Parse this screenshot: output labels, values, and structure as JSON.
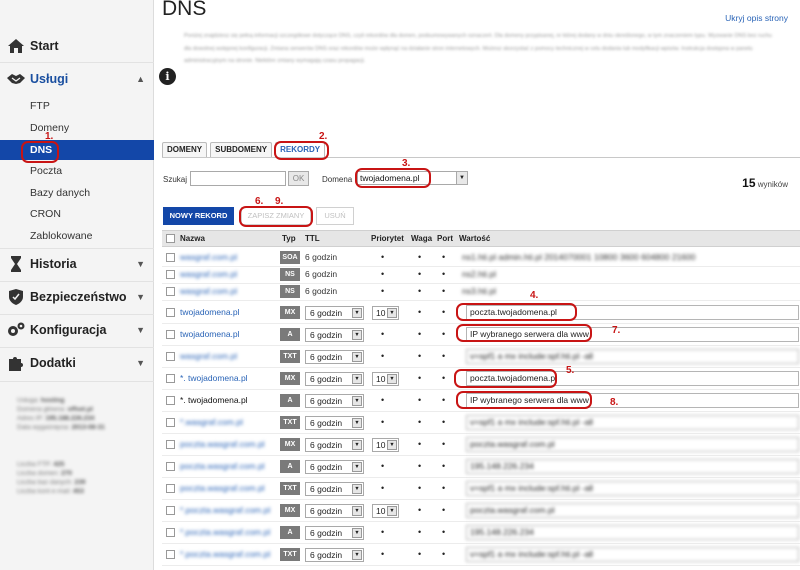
{
  "sidebar": {
    "items": [
      {
        "label": "Start",
        "icon": "home-icon"
      },
      {
        "label": "Usługi",
        "icon": "handshake-icon"
      },
      {
        "label": "Historia",
        "icon": "hourglass-icon"
      },
      {
        "label": "Bezpieczeństwo",
        "icon": "shield-icon"
      },
      {
        "label": "Konfiguracja",
        "icon": "gears-icon"
      },
      {
        "label": "Dodatki",
        "icon": "puzzle-icon"
      }
    ],
    "subitems": [
      "FTP",
      "Domeny",
      "DNS",
      "Poczta",
      "Bazy danych",
      "CRON",
      "Zablokowane"
    ],
    "account_stats": [
      {
        "label": "Usługa:",
        "value": "hosting"
      },
      {
        "label": "Domena główna:",
        "value": "offset.pl"
      },
      {
        "label": "Adres IP:",
        "value": "195.188.226.234"
      },
      {
        "label": "Data wygaśnięcia:",
        "value": "2013-08-31"
      }
    ],
    "usage_stats": [
      {
        "label": "Liczba FTP:",
        "value": "425"
      },
      {
        "label": "Liczba domen:",
        "value": "270"
      },
      {
        "label": "Liczba baz danych:",
        "value": "239"
      },
      {
        "label": "Liczba kont e-mail:",
        "value": "453"
      }
    ]
  },
  "page": {
    "title": "DNS",
    "hide_link": "Ukryj opis strony",
    "description": "Poniżej znajdziesz się pełną informacji szczegółowe dotyczące DNS, czyli rekordów dla domen, podsumowywanych oznaczeń. Dla domeny przypisanej, nr której dodany w dniu określonego, w tym znaczeniem typu. Wyzwanie DNS bez ruchu dla dowolnej wstępnej konfiguracji. Zmiana serwerów DNS oraz rekordów może wpłynąć na działanie stron internetowych. Możesz skorzystać z pomocy technicznej w celu dodania lub modyfikacji wpisów. Instrukcja dostępna w panelu administracyjnym na stronie. Niektóre zmiany wymagają czasu propagacji."
  },
  "tabs": [
    "DOMENY",
    "SUBDOMENY",
    "REKORDY"
  ],
  "filters": {
    "search_label": "Szukaj",
    "search_value": "",
    "ok_label": "OK",
    "domain_label": "Domena",
    "domain_value": "twojadomena.pl",
    "results_count": "15",
    "results_label": "wyników"
  },
  "actions": {
    "new_record": "NOWY REKORD",
    "save": "ZAPISZ ZMIANY",
    "delete": "USUŃ"
  },
  "columns": [
    "Nazwa",
    "Typ",
    "TTL",
    "Priorytet",
    "Waga",
    "Port",
    "Wartość"
  ],
  "records": [
    {
      "name": "wasgraf.com.pl",
      "type": "SOA",
      "ttl": "6 godzin",
      "priority": "",
      "value": "ns1.hti.pl admin.hti.pl 2014070001 10800 3600 604800 21600",
      "editable": false,
      "blur_name": true,
      "blur_value": true,
      "dark": false
    },
    {
      "name": "wasgraf.com.pl",
      "type": "NS",
      "ttl": "6 godzin",
      "priority": "",
      "value": "ns2.hti.pl",
      "editable": false,
      "blur_name": true,
      "blur_value": true,
      "dark": false
    },
    {
      "name": "wasgraf.com.pl",
      "type": "NS",
      "ttl": "6 godzin",
      "priority": "",
      "value": "ns3.hti.pl",
      "editable": false,
      "blur_name": true,
      "blur_value": true,
      "dark": false
    },
    {
      "name": "twojadomena.pl",
      "type": "MX",
      "ttl": "6 godzin",
      "priority": "10",
      "value": "poczta.twojadomena.pl",
      "editable": true,
      "blur_name": false,
      "blur_value": false,
      "dark": false
    },
    {
      "name": "twojadomena.pl",
      "type": "A",
      "ttl": "6 godzin",
      "priority": "",
      "value": "IP wybranego serwera dla www",
      "editable": true,
      "blur_name": false,
      "blur_value": false,
      "dark": false
    },
    {
      "name": "wasgraf.com.pl",
      "type": "TXT",
      "ttl": "6 godzin",
      "priority": "",
      "value": "v=spf1 a mx include:spf.hti.pl -all",
      "editable": true,
      "blur_name": true,
      "blur_value": true,
      "dark": false
    },
    {
      "name": "*. twojadomena.pl",
      "type": "MX",
      "ttl": "6 godzin",
      "priority": "10",
      "value": "poczta.twojadomena.pl",
      "editable": true,
      "blur_name": false,
      "blur_value": false,
      "dark": false
    },
    {
      "name": "*. twojadomena.pl",
      "type": "A",
      "ttl": "6 godzin",
      "priority": "",
      "value": "IP wybranego serwera dla www",
      "editable": true,
      "blur_name": false,
      "blur_value": false,
      "dark": true
    },
    {
      "name": "*.wasgraf.com.pl",
      "type": "TXT",
      "ttl": "6 godzin",
      "priority": "",
      "value": "v=spf1 a mx include:spf.hti.pl -all",
      "editable": true,
      "blur_name": true,
      "blur_value": true,
      "dark": false
    },
    {
      "name": "poczta.wasgraf.com.pl",
      "type": "MX",
      "ttl": "6 godzin",
      "priority": "10",
      "value": "poczta.wasgraf.com.pl",
      "editable": true,
      "blur_name": true,
      "blur_value": true,
      "dark": false
    },
    {
      "name": "poczta.wasgraf.com.pl",
      "type": "A",
      "ttl": "6 godzin",
      "priority": "",
      "value": "195.148.226.234",
      "editable": true,
      "blur_name": true,
      "blur_value": true,
      "dark": false
    },
    {
      "name": "poczta.wasgraf.com.pl",
      "type": "TXT",
      "ttl": "6 godzin",
      "priority": "",
      "value": "v=spf1 a mx include:spf.hti.pl -all",
      "editable": true,
      "blur_name": true,
      "blur_value": true,
      "dark": false
    },
    {
      "name": "*.poczta.wasgraf.com.pl",
      "type": "MX",
      "ttl": "6 godzin",
      "priority": "10",
      "value": "poczta.wasgraf.com.pl",
      "editable": true,
      "blur_name": true,
      "blur_value": true,
      "dark": false
    },
    {
      "name": "*.poczta.wasgraf.com.pl",
      "type": "A",
      "ttl": "6 godzin",
      "priority": "",
      "value": "195.148.226.234",
      "editable": true,
      "blur_name": true,
      "blur_value": true,
      "dark": false
    },
    {
      "name": "*.poczta.wasgraf.com.pl",
      "type": "TXT",
      "ttl": "6 godzin",
      "priority": "",
      "value": "v=spf1 a mx include:spf.hti.pl -all",
      "editable": true,
      "blur_name": true,
      "blur_value": true,
      "dark": false
    }
  ],
  "annotations": [
    "1.",
    "2.",
    "3.",
    "4.",
    "5.",
    "6.",
    "7.",
    "8.",
    "9."
  ],
  "colors": {
    "accent": "#1347a8",
    "link": "#2a64b7",
    "annotation": "#c81414",
    "badge": "#7a7a7a"
  }
}
